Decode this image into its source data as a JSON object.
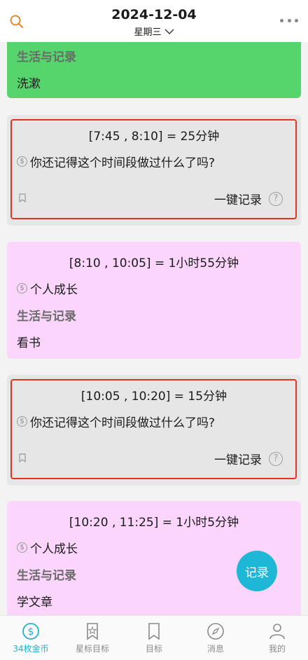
{
  "header": {
    "date": "2024-12-04",
    "weekday": "星期三"
  },
  "cards": [
    {
      "kind": "activity",
      "category": "生活与记录",
      "activity": "洗漱"
    },
    {
      "kind": "unrecorded",
      "range": "[7:45 , 8:10] = 25分钟",
      "prompt": "你还记得这个时间段做过什么了吗?",
      "action": "一键记录"
    },
    {
      "kind": "activity",
      "range": "[8:10 , 10:05] = 1小时55分钟",
      "goal": "个人成长",
      "category": "生活与记录",
      "activity": "看书"
    },
    {
      "kind": "unrecorded",
      "range": "[10:05 , 10:20] = 15分钟",
      "prompt": "你还记得这个时间段做过什么了吗?",
      "action": "一键记录"
    },
    {
      "kind": "activity",
      "range": "[10:20 , 11:25] = 1小时5分钟",
      "goal": "个人成长",
      "category": "生活与记录",
      "activity": "学文章"
    }
  ],
  "fab": {
    "label": "记录"
  },
  "tabbar": {
    "items": [
      {
        "label": "34枚金币",
        "icon": "coin-icon",
        "active": true
      },
      {
        "label": "星标目标",
        "icon": "star-bookmark-icon",
        "active": false
      },
      {
        "label": "目标",
        "icon": "bookmark-icon",
        "active": false
      },
      {
        "label": "消息",
        "icon": "compass-icon",
        "active": false
      },
      {
        "label": "我的",
        "icon": "person-icon",
        "active": false
      }
    ]
  },
  "colors": {
    "green_card": "#55d56b",
    "pink_card": "#fcd5fc",
    "gray_card": "#e6e6e6",
    "highlight": "#e23422",
    "accent": "#22b2cf",
    "fab": "#1fb7d6",
    "search_icon": "#e8892b"
  }
}
